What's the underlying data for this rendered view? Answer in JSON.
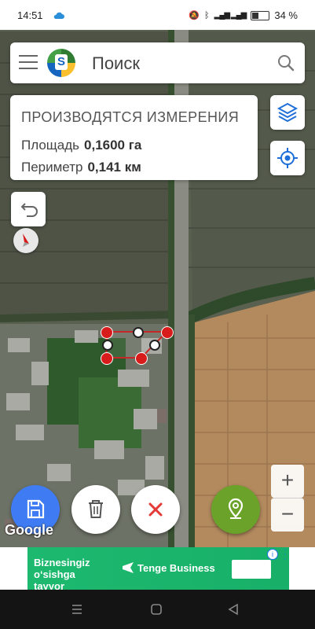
{
  "status_bar": {
    "time": "14:51",
    "battery": "34 %"
  },
  "search": {
    "placeholder": "Поиск",
    "app_logo_letter": "S"
  },
  "measurement": {
    "title": "ПРОИЗВОДЯТСЯ ИЗМЕРЕНИЯ",
    "area_label": "Площадь",
    "area_value": "0,1600 га",
    "perimeter_label": "Периметр",
    "perimeter_value": "0,141 км"
  },
  "map": {
    "attribution": "Google",
    "zoom_in": "+",
    "zoom_out": "−"
  },
  "ad": {
    "text": "Biznesingiz o‘sishga tayyor",
    "brand": "Tenge Business"
  },
  "colors": {
    "save": "#3f7cf4",
    "delete_x": "#e53935",
    "location": "#6aa22a",
    "marker": "#d81b1b"
  }
}
